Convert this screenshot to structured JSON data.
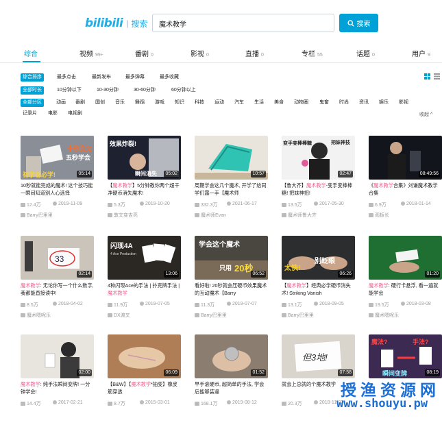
{
  "header": {
    "logo": "bilibili",
    "logo_suffix": "搜索",
    "search_value": "魔术教学",
    "search_button": "搜索"
  },
  "tabs": [
    {
      "label": "综合",
      "count": ""
    },
    {
      "label": "视频",
      "count": "99+"
    },
    {
      "label": "番剧",
      "count": "0"
    },
    {
      "label": "影视",
      "count": "0"
    },
    {
      "label": "直播",
      "count": "0"
    },
    {
      "label": "专栏",
      "count": "55"
    },
    {
      "label": "话题",
      "count": "0"
    },
    {
      "label": "用户",
      "count": "9"
    }
  ],
  "filters": {
    "sort": [
      "综合排序",
      "最多点击",
      "最新发布",
      "最多弹幕",
      "最多收藏"
    ],
    "duration": [
      "全部时长",
      "10分钟以下",
      "10-30分钟",
      "30-60分钟",
      "60分钟以上"
    ],
    "zone": [
      "全部分区",
      "动画",
      "番剧",
      "国创",
      "音乐",
      "舞蹈",
      "游戏",
      "知识",
      "科技",
      "运动",
      "汽车",
      "生活",
      "美食",
      "动物圈",
      "鬼畜",
      "时尚",
      "资讯",
      "娱乐",
      "影视",
      "记录片",
      "电影",
      "电视剧"
    ],
    "collapse": "收起 ^"
  },
  "videos": [
    {
      "duration": "05:14",
      "title_pre": "10秒就能完成的魔术! 这个技巧能一瞬间知道别人心选择",
      "title_hl": "",
      "title_post": "",
      "views": "12.4万",
      "date": "2019-11-09",
      "uploader": "Barry巴里里"
    },
    {
      "duration": "05:02",
      "title_pre": "【",
      "title_hl": "魔术教学",
      "title_post": "】5分钟教你两个超干净硬币消失魔术!",
      "views": "5.3万",
      "date": "2019-10-20",
      "uploader": "敦文变吉亮"
    },
    {
      "duration": "10:57",
      "title_pre": "周期学会这几个魔术, 开学了给同学们露一手【魔术师",
      "title_hl": "",
      "title_post": "",
      "views": "332.3万",
      "date": "2021-06-17",
      "uploader": "魔术师Evan"
    },
    {
      "duration": "02:47",
      "title_pre": "【鲁大齐】",
      "title_hl": "魔术教学",
      "title_post": "-变手变棒棒糖! 把妹神招!",
      "views": "13.5万",
      "date": "2017-05-30",
      "uploader": "魔术师鲁大齐"
    },
    {
      "duration": "08:49:56",
      "title_pre": "《",
      "title_hl": "魔术教学",
      "title_post": "合集》刘谦魔术教学合集",
      "views": "6.9万",
      "date": "2018-01-14",
      "uploader": "观板长"
    },
    {
      "duration": "02:14",
      "title_pre": "",
      "title_hl": "魔术教学",
      "title_post": ": 无论你写一个什么数字, 我都能直接读中!",
      "views": "8.5万",
      "date": "2018-04-02",
      "uploader": "魔术嗯呢乐"
    },
    {
      "duration": "13:06",
      "title_pre": "4种闪现Ace的手法 | 扑克牌手法 | ",
      "title_hl": "魔术教学",
      "title_post": "",
      "views": "11.9万",
      "date": "2019-07-05",
      "uploader": "DX渡叉"
    },
    {
      "duration": "06:52",
      "title_pre": "看好啦! 20秒就会压硬币效果魔术的互动魔术【Barry",
      "title_hl": "",
      "title_post": "",
      "views": "11.3万",
      "date": "2019-07-07",
      "uploader": "Barry巴里里"
    },
    {
      "duration": "06:26",
      "title_pre": "【",
      "title_hl": "魔术教学",
      "title_post": "】经典必学硬币消失术! Striking Vanish",
      "views": "13.1万",
      "date": "2018-09-05",
      "uploader": "Barry巴里里"
    },
    {
      "duration": "01:20",
      "title_pre": "",
      "title_hl": "魔术教学",
      "title_post": ": 硬行卡悬浮, 看一遍就能学会",
      "views": "19.5万",
      "date": "2018-03-08",
      "uploader": "魔术嗯呢乐"
    },
    {
      "duration": "02:00",
      "title_pre": "",
      "title_hl": "魔术教学",
      "title_post": ": 纯手法瞬间变牌! 一分钟学会!",
      "views": "14.4万",
      "date": "2017-02-21",
      "uploader": "魔术嗯呢乐"
    },
    {
      "duration": "06:09",
      "title_pre": "【B&W】【",
      "title_hl": "魔术教学",
      "title_post": "*抽变】橡皮筋穿透",
      "views": "8.7万",
      "date": "2015-03-01",
      "uploader": "Black&White"
    },
    {
      "duration": "01:52",
      "title_pre": "早手滚硬币, 超简单的手法, 学会后能够装逼",
      "title_hl": "",
      "title_post": "",
      "views": "168.1万",
      "date": "2019-08-12",
      "uploader": "魔术师Evan"
    },
    {
      "duration": "07:58",
      "title_pre": "就会上总就的个魔术教学",
      "title_hl": "",
      "title_post": "",
      "views": "20.3万",
      "date": "2018-11-03",
      "uploader": "魔术嗯呢乐"
    },
    {
      "duration": "08:19",
      "title_pre": "",
      "title_hl": "",
      "title_post": "",
      "views": "",
      "date": "",
      "uploader": ""
    }
  ],
  "thumb_text": {
    "t1a": "十秒变完",
    "t1b": "五秒学会",
    "t1c": "初学者必学!",
    "t2a": "效果炸裂!",
    "t2b": "瞬间消失",
    "t4a": "变手变棒棒糖",
    "t4b": "把妹神技",
    "t6": "33",
    "t7a": "闪现4A",
    "t7b": "4 Ace Production",
    "t8a": "学会这个魔术",
    "t8b": "只用",
    "t8c": "20秒",
    "t9a": "太快!",
    "t9b": "别眨眼",
    "t14": "但3地!",
    "t15a": "魔法?",
    "t15b": "手法?",
    "t15c": "瞬间变牌"
  },
  "watermark": {
    "line1": "授渔资源网",
    "line2": "www.shouyu.pw"
  },
  "colors": {
    "accent": "#00a1d6",
    "highlight": "#f25d8e",
    "watermark": "#1d6fd6"
  }
}
